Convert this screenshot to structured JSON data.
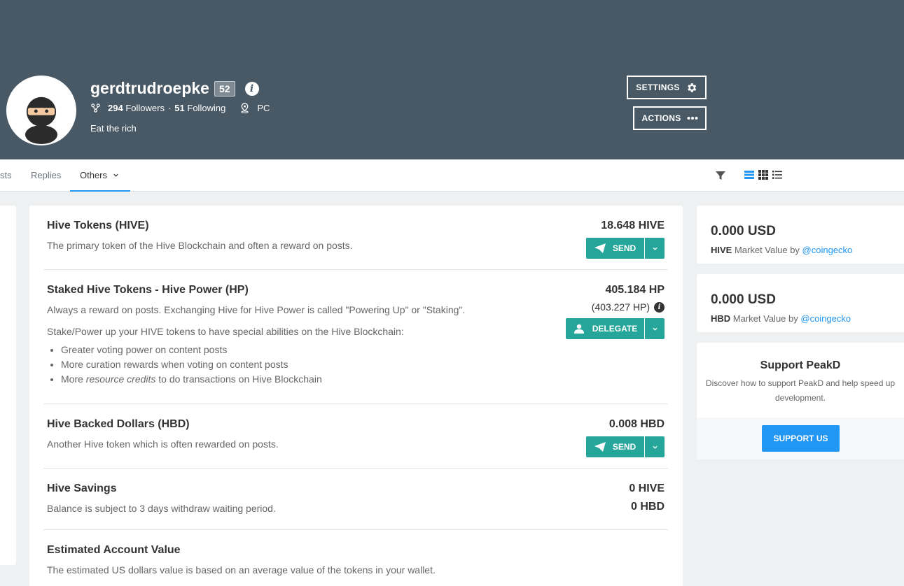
{
  "profile": {
    "username": "gerdtrudroepke",
    "reputation": "52",
    "followers_count": "294",
    "followers_label": "Followers",
    "separator": "·",
    "following_count": "51",
    "following_label": "Following",
    "location": "PC",
    "bio": "Eat the rich"
  },
  "header_buttons": {
    "settings": "SETTINGS",
    "actions": "ACTIONS"
  },
  "tabs": {
    "posts_partial": "sts",
    "replies": "Replies",
    "others": "Others"
  },
  "wallet": {
    "hive": {
      "title": "Hive Tokens (HIVE)",
      "desc": "The primary token of the Hive Blockchain and often a reward on posts.",
      "amount": "18.648 HIVE",
      "button": "SEND"
    },
    "hp": {
      "title": "Staked Hive Tokens - Hive Power (HP)",
      "desc": "Always a reward on posts. Exchanging Hive for Hive Power is called \"Powering Up\" or \"Staking\".",
      "desc2": "Stake/Power up your HIVE tokens to have special abilities on the Hive Blockchain:",
      "bullets": [
        "Greater voting power on content posts",
        "More curation rewards when voting on content posts"
      ],
      "bullet3_prefix": "More ",
      "bullet3_em": "resource credits",
      "bullet3_suffix": " to do transactions on Hive Blockchain",
      "amount": "405.184 HP",
      "sub_amount": "(403.227 HP)",
      "button": "DELEGATE"
    },
    "hbd": {
      "title": "Hive Backed Dollars (HBD)",
      "desc": "Another Hive token which is often rewarded on posts.",
      "amount": "0.008 HBD",
      "button": "SEND"
    },
    "savings": {
      "title": "Hive Savings",
      "desc": "Balance is subject to 3 days withdraw waiting period.",
      "hive_amount": "0 HIVE",
      "hbd_amount": "0 HBD"
    },
    "estimated": {
      "title": "Estimated Account Value",
      "desc": "The estimated US dollars value is based on an average value of the tokens in your wallet."
    }
  },
  "market": {
    "hive": {
      "usd": "0.000 USD",
      "token": "HIVE",
      "text": " Market Value by ",
      "link": "@coingecko"
    },
    "hbd": {
      "usd": "0.000 USD",
      "token": "HBD",
      "text": " Market Value by ",
      "link": "@coingecko"
    }
  },
  "support": {
    "title": "Support PeakD",
    "desc": "Discover how to support PeakD and help speed up development.",
    "button": "SUPPORT US"
  },
  "colors": {
    "header_bg": "#485965",
    "accent_teal": "#26a69a",
    "accent_blue": "#2196f3"
  }
}
